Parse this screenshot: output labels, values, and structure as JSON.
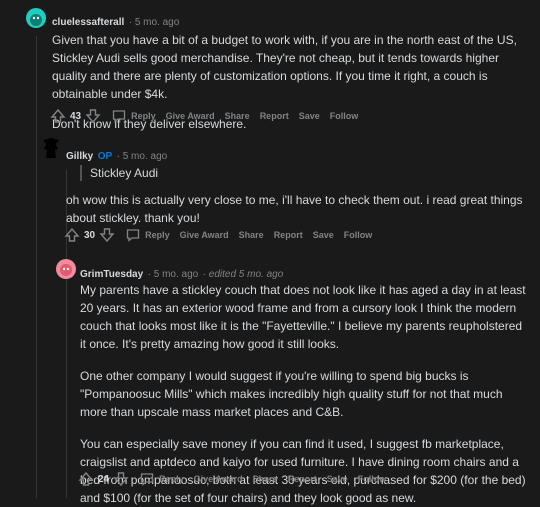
{
  "comments": [
    {
      "username": "cluelessafterall",
      "time": "5 mo. ago",
      "paragraphs": [
        "Given that you have a bit of a budget to work with, if you are in the north east of the US, Stickley Audi sells good merchandise. They're not cheap, but it tends towards higher quality and there are plenty of customization options. If you time it right, a couch is obtainable under $4k.",
        "Don't know if they deliver elsewhere."
      ],
      "votes": "43",
      "actions": [
        "Reply",
        "Give Award",
        "Share",
        "Report",
        "Save",
        "Follow"
      ]
    },
    {
      "username": "Gillky",
      "op_label": "OP",
      "time": "5 mo. ago",
      "quote": "Stickley Audi",
      "paragraphs": [
        "oh wow this is actually very close to me, i'll have to check them out. i read great things about stickley. thank you!"
      ],
      "votes": "30",
      "actions": [
        "Reply",
        "Give Award",
        "Share",
        "Report",
        "Save",
        "Follow"
      ]
    },
    {
      "username": "GrimTuesday",
      "time": "5 mo. ago",
      "edited": "edited 5 mo. ago",
      "paragraphs": [
        "My parents have a stickley couch that does not look like it has aged a day in at least 20 years. It has an exterior wood frame and from a cursory look I think the modern couch that looks most like it is the \"Fayetteville.\" I believe my parents reupholstered it once. It's pretty amazing how good it still looks.",
        "One other company I would suggest if you're willing to spend big bucks is \"Pompanoosuc Mills\" which makes incredibly high quality stuff for not that much more than upscale mass market places and C&B.",
        "You can especially save money if you can find it used, I suggest fb marketplace, craigslist and aptdeco and kaiyo for used furniture. I have dining room chairs and a bed from pompanoosuc, both at least 30 years old, purchased for $200 (for the bed) and $100 (for the set of four chairs) and they look good as new."
      ],
      "votes": "24",
      "actions": [
        "Reply",
        "Give Award",
        "Share",
        "Report",
        "Save",
        "Follow"
      ]
    }
  ],
  "colors": {
    "background": "#1a1a1b",
    "text": "#d7dadc",
    "meta": "#818384",
    "op": "#0079d3"
  },
  "icons": [
    "upvote-icon",
    "downvote-icon",
    "reply-icon"
  ]
}
